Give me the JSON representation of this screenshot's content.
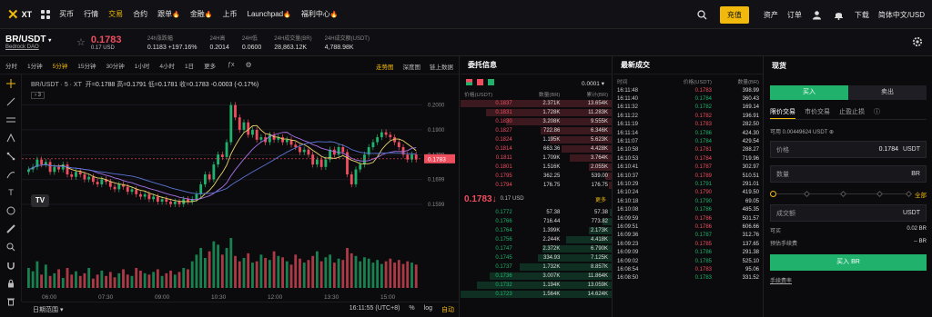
{
  "nav": {
    "logo_text": "XT",
    "items": [
      {
        "label": "买币",
        "active": false
      },
      {
        "label": "行情",
        "active": false
      },
      {
        "label": "交易",
        "active": true
      },
      {
        "label": "合约",
        "active": false
      },
      {
        "label": "跟单",
        "hot": true
      },
      {
        "label": "金融",
        "hot": true
      },
      {
        "label": "上币",
        "active": false
      },
      {
        "label": "Launchpad",
        "hot": true
      },
      {
        "label": "福利中心",
        "hot": true
      }
    ],
    "deposit": "充值",
    "assets": "资产",
    "orders": "订单",
    "download": "下载",
    "language": "简体中文/USD"
  },
  "ticker": {
    "symbol": "BR/USDT",
    "project": "Bedrock DAO",
    "price": "0.1783",
    "price_usd": "0.17 USD",
    "stats": [
      {
        "label": "24h涨跌幅",
        "value": "0.1183 +197.16%",
        "color": "up"
      },
      {
        "label": "24H高",
        "value": "0.2014"
      },
      {
        "label": "24H低",
        "value": "0.0600"
      },
      {
        "label": "24H成交量(BR)",
        "value": "28,863.12K"
      },
      {
        "label": "24H成交额(USDT)",
        "value": "4,788.98K"
      }
    ]
  },
  "chart_panel": {
    "timeframes": [
      "分时",
      "1分钟",
      "5分钟",
      "15分钟",
      "30分钟",
      "1小时",
      "4小时",
      "1日",
      "更多"
    ],
    "active_tf": "5分钟",
    "views": [
      "走势图",
      "深度图",
      "链上数据"
    ],
    "active_view": "走势图",
    "info_title": "BR/USDT · 5 · XT",
    "ohlc": {
      "open": "0.1788",
      "high": "0.1791",
      "low": "0.1781",
      "close": "0.1783",
      "change": "-0.0003 (-0.17%)"
    },
    "hidden_count": "3",
    "range_label": "日期范围",
    "time": "16:11:55 (UTC+8)",
    "pct": "%",
    "log": "log",
    "auto": "自动"
  },
  "chart_data": {
    "type": "candlestick",
    "ylim": [
      0.15,
      0.205
    ],
    "y_ticks": [
      "0.2000",
      "0.1900",
      "0.1799",
      "0.1699",
      "0.1599"
    ],
    "x_ticks": [
      "06:00",
      "07:30",
      "09:00",
      "10:30",
      "12:00",
      "13:30",
      "15:00"
    ],
    "last_price_label": "0.1783",
    "candles_close": [
      0.174,
      0.175,
      0.178,
      0.176,
      0.177,
      0.173,
      0.175,
      0.174,
      0.176,
      0.172,
      0.171,
      0.173,
      0.172,
      0.17,
      0.171,
      0.169,
      0.168,
      0.17,
      0.169,
      0.167,
      0.166,
      0.168,
      0.167,
      0.165,
      0.166,
      0.164,
      0.163,
      0.164,
      0.162,
      0.163,
      0.161,
      0.162,
      0.161,
      0.16,
      0.161,
      0.16,
      0.162,
      0.161,
      0.162,
      0.164,
      0.168,
      0.172,
      0.17,
      0.176,
      0.18,
      0.179,
      0.185,
      0.2,
      0.195,
      0.19,
      0.193,
      0.188,
      0.19,
      0.186,
      0.187,
      0.185,
      0.188,
      0.186,
      0.187,
      0.185,
      0.186,
      0.184,
      0.183,
      0.181,
      0.182,
      0.18,
      0.176,
      0.178,
      0.175,
      0.178,
      0.182,
      0.18,
      0.183,
      0.181,
      0.172,
      0.168,
      0.174,
      0.176,
      0.18,
      0.183,
      0.185,
      0.187,
      0.189,
      0.188,
      0.187,
      0.185,
      0.183,
      0.18,
      0.178,
      0.18,
      0.178
    ],
    "volumes": [
      30,
      25,
      40,
      20,
      35,
      18,
      22,
      28,
      15,
      30,
      20,
      25,
      18,
      22,
      30,
      14,
      20,
      26,
      18,
      24,
      16,
      22,
      28,
      20,
      18,
      30,
      26,
      22,
      20,
      24,
      28,
      18,
      22,
      26,
      20,
      24,
      30,
      28,
      40,
      50,
      60,
      45,
      55,
      70,
      65,
      50,
      60,
      75,
      48,
      40,
      45,
      52,
      38,
      40,
      50,
      45,
      42,
      55,
      48,
      46,
      40,
      35,
      50,
      44,
      38,
      42,
      48,
      55,
      40,
      46,
      50,
      38,
      44,
      42,
      60,
      52,
      48,
      40,
      46,
      44,
      38,
      42,
      36,
      40,
      44,
      38,
      42,
      36,
      40,
      38,
      35
    ]
  },
  "orderbook": {
    "title": "委托信息",
    "precision": "0.0001",
    "headers": [
      "价格(USDT)",
      "数量(BR)",
      "累计(BR)"
    ],
    "asks": [
      [
        "0.1837",
        "2.371K",
        "13.654K",
        1.0
      ],
      [
        "0.1831",
        "1.728K",
        "11.283K",
        0.83
      ],
      [
        "0.1830",
        "3.208K",
        "9.555K",
        0.7
      ],
      [
        "0.1827",
        "722.86",
        "6.346K",
        0.47
      ],
      [
        "0.1824",
        "1.195K",
        "5.623K",
        0.41
      ],
      [
        "0.1814",
        "663.36",
        "4.428K",
        0.33
      ],
      [
        "0.1811",
        "1.709K",
        "3.764K",
        0.28
      ],
      [
        "0.1801",
        "1.516K",
        "2.055K",
        0.15
      ],
      [
        "0.1795",
        "362.25",
        "539.00",
        0.04
      ],
      [
        "0.1794",
        "176.75",
        "176.75",
        0.02
      ]
    ],
    "mid_price": "0.1783",
    "mid_arrow": "↓",
    "mid_usd": "0.17 USD",
    "more": "更多",
    "bids": [
      [
        "0.1772",
        "57.38",
        "57.38",
        0.01
      ],
      [
        "0.1766",
        "716.44",
        "773.82",
        0.06
      ],
      [
        "0.1764",
        "1.399K",
        "2.173K",
        0.15
      ],
      [
        "0.1756",
        "2.244K",
        "4.418K",
        0.3
      ],
      [
        "0.1747",
        "2.372K",
        "6.790K",
        0.46
      ],
      [
        "0.1745",
        "334.93",
        "7.125K",
        0.49
      ],
      [
        "0.1737",
        "1.732K",
        "8.857K",
        0.61
      ],
      [
        "0.1736",
        "3.007K",
        "11.864K",
        0.81
      ],
      [
        "0.1732",
        "1.194K",
        "13.059K",
        0.89
      ],
      [
        "0.1723",
        "1.564K",
        "14.624K",
        1.0
      ]
    ]
  },
  "trades": {
    "title": "最新成交",
    "headers": [
      "时间",
      "价格(USDT)",
      "数量(BR)"
    ],
    "rows": [
      [
        "16:11:48",
        "0.1783",
        "398.99",
        "down"
      ],
      [
        "16:11:40",
        "0.1784",
        "360.43",
        "up"
      ],
      [
        "16:11:32",
        "0.1782",
        "169.14",
        "up"
      ],
      [
        "16:11:22",
        "0.1782",
        "196.91",
        "down"
      ],
      [
        "16:11:19",
        "0.1783",
        "282.50",
        "down"
      ],
      [
        "16:11:14",
        "0.1786",
        "424.30",
        "up"
      ],
      [
        "16:11:07",
        "0.1784",
        "429.54",
        "up"
      ],
      [
        "16:10:58",
        "0.1781",
        "288.27",
        "down"
      ],
      [
        "16:10:53",
        "0.1784",
        "719.96",
        "down"
      ],
      [
        "16:10:41",
        "0.1787",
        "302.97",
        "down"
      ],
      [
        "16:10:37",
        "0.1789",
        "510.51",
        "down"
      ],
      [
        "16:10:29",
        "0.1791",
        "291.01",
        "up"
      ],
      [
        "16:10:24",
        "0.1790",
        "419.50",
        "down"
      ],
      [
        "16:10:18",
        "0.1790",
        "69.05",
        "up"
      ],
      [
        "16:10:08",
        "0.1786",
        "485.35",
        "up"
      ],
      [
        "16:09:59",
        "0.1786",
        "501.57",
        "down"
      ],
      [
        "16:09:51",
        "0.1786",
        "606.66",
        "down"
      ],
      [
        "16:09:36",
        "0.1787",
        "312.76",
        "up"
      ],
      [
        "16:09:23",
        "0.1785",
        "137.65",
        "down"
      ],
      [
        "16:09:09",
        "0.1786",
        "291.38",
        "up"
      ],
      [
        "16:09:02",
        "0.1785",
        "525.10",
        "up"
      ],
      [
        "16:08:54",
        "0.1783",
        "95.06",
        "down"
      ],
      [
        "16:08:50",
        "0.1783",
        "331.52",
        "up"
      ]
    ]
  },
  "form": {
    "title": "现货",
    "buy_tab": "买入",
    "sell_tab": "卖出",
    "order_types": [
      "限价交易",
      "市价交易",
      "止盈止损"
    ],
    "available": "可用 0.00449624 USDT",
    "price_label": "价格",
    "price_value": "0.1784",
    "price_unit": "USDT",
    "qty_label": "数量",
    "qty_unit": "BR",
    "all_label": "全部",
    "amount_label": "成交额",
    "amount_unit": "USDT",
    "can_buy_label": "可买",
    "can_buy_value": "0.02 BR",
    "fee_label": "预估手续费",
    "fee_value": "-- BR",
    "buy_button": "买入 BR",
    "fee_link": "手续费率"
  }
}
